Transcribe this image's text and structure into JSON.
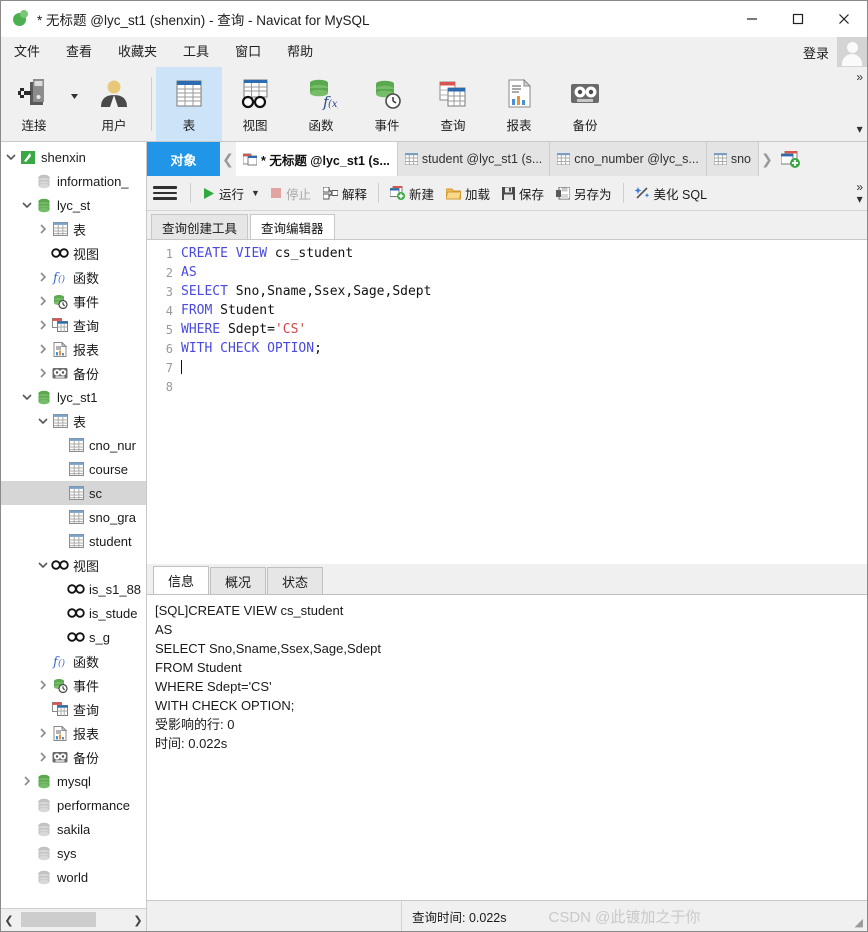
{
  "window": {
    "title": "* 无标题 @lyc_st1 (shenxin) - 查询 - Navicat for MySQL",
    "minimize": "—",
    "maximize": "□",
    "close": "✕"
  },
  "menubar": {
    "items": [
      {
        "label": "文件"
      },
      {
        "label": "查看"
      },
      {
        "label": "收藏夹"
      },
      {
        "label": "工具"
      },
      {
        "label": "窗口"
      },
      {
        "label": "帮助"
      }
    ],
    "login_label": "登录"
  },
  "ribbon": {
    "items": [
      {
        "label": "连接",
        "icon": "connection-icon",
        "selected": false
      },
      {
        "label": "用户",
        "icon": "user-icon",
        "selected": false
      },
      {
        "label": "表",
        "icon": "table-icon",
        "selected": true
      },
      {
        "label": "视图",
        "icon": "view-icon",
        "selected": false
      },
      {
        "label": "函数",
        "icon": "function-icon",
        "selected": false
      },
      {
        "label": "事件",
        "icon": "event-icon",
        "selected": false
      },
      {
        "label": "查询",
        "icon": "query-icon",
        "selected": false
      },
      {
        "label": "报表",
        "icon": "report-icon",
        "selected": false
      },
      {
        "label": "备份",
        "icon": "backup-icon",
        "selected": false
      }
    ],
    "overflow": "»",
    "more": "▾"
  },
  "sidebar": {
    "tree": [
      {
        "label": "shenxin",
        "indent": 0,
        "icon": "connection-icon",
        "arrow": "down",
        "state": "active"
      },
      {
        "label": "information_",
        "indent": 1,
        "icon": "database-gray",
        "arrow": "none",
        "state": "closed"
      },
      {
        "label": "lyc_st",
        "indent": 1,
        "icon": "database-green",
        "arrow": "down",
        "state": "open"
      },
      {
        "label": "表",
        "indent": 2,
        "icon": "table-icon",
        "arrow": "right",
        "state": "closed"
      },
      {
        "label": "视图",
        "indent": 2,
        "icon": "view-icon",
        "arrow": "none",
        "state": "closed"
      },
      {
        "label": "函数",
        "indent": 2,
        "icon": "function-icon",
        "arrow": "right",
        "state": "closed"
      },
      {
        "label": "事件",
        "indent": 2,
        "icon": "event-icon",
        "arrow": "right",
        "state": "closed"
      },
      {
        "label": "查询",
        "indent": 2,
        "icon": "query-icon",
        "arrow": "right",
        "state": "closed"
      },
      {
        "label": "报表",
        "indent": 2,
        "icon": "report-icon",
        "arrow": "right",
        "state": "closed"
      },
      {
        "label": "备份",
        "indent": 2,
        "icon": "backup-icon",
        "arrow": "right",
        "state": "closed"
      },
      {
        "label": "lyc_st1",
        "indent": 1,
        "icon": "database-green",
        "arrow": "down",
        "state": "open"
      },
      {
        "label": "表",
        "indent": 2,
        "icon": "table-icon",
        "arrow": "down",
        "state": "open"
      },
      {
        "label": "cno_nur",
        "indent": 3,
        "icon": "table-icon",
        "arrow": "none",
        "state": "closed"
      },
      {
        "label": "course",
        "indent": 3,
        "icon": "table-icon",
        "arrow": "none",
        "state": "closed"
      },
      {
        "label": "sc",
        "indent": 3,
        "icon": "table-icon",
        "arrow": "none",
        "state": "selected"
      },
      {
        "label": "sno_gra",
        "indent": 3,
        "icon": "table-icon",
        "arrow": "none",
        "state": "closed"
      },
      {
        "label": "student",
        "indent": 3,
        "icon": "table-icon",
        "arrow": "none",
        "state": "closed"
      },
      {
        "label": "视图",
        "indent": 2,
        "icon": "view-icon",
        "arrow": "down",
        "state": "open"
      },
      {
        "label": "is_s1_88",
        "indent": 3,
        "icon": "view-icon",
        "arrow": "none",
        "state": "closed"
      },
      {
        "label": "is_stude",
        "indent": 3,
        "icon": "view-icon",
        "arrow": "none",
        "state": "closed"
      },
      {
        "label": "s_g",
        "indent": 3,
        "icon": "view-icon",
        "arrow": "none",
        "state": "closed"
      },
      {
        "label": "函数",
        "indent": 2,
        "icon": "function-icon",
        "arrow": "none",
        "state": "closed"
      },
      {
        "label": "事件",
        "indent": 2,
        "icon": "event-icon",
        "arrow": "right",
        "state": "closed"
      },
      {
        "label": "查询",
        "indent": 2,
        "icon": "query-icon",
        "arrow": "none",
        "state": "closed"
      },
      {
        "label": "报表",
        "indent": 2,
        "icon": "report-icon",
        "arrow": "right",
        "state": "closed"
      },
      {
        "label": "备份",
        "indent": 2,
        "icon": "backup-icon",
        "arrow": "right",
        "state": "closed"
      },
      {
        "label": "mysql",
        "indent": 1,
        "icon": "database-green",
        "arrow": "right",
        "state": "closed"
      },
      {
        "label": "performance",
        "indent": 1,
        "icon": "database-gray",
        "arrow": "none",
        "state": "closed"
      },
      {
        "label": "sakila",
        "indent": 1,
        "icon": "database-gray",
        "arrow": "none",
        "state": "closed"
      },
      {
        "label": "sys",
        "indent": 1,
        "icon": "database-gray",
        "arrow": "none",
        "state": "closed"
      },
      {
        "label": "world",
        "indent": 1,
        "icon": "database-gray",
        "arrow": "none",
        "state": "closed"
      }
    ],
    "scroll_left": "❮",
    "scroll_right": "❯"
  },
  "doctabs": {
    "object_label": "对象",
    "nav_prev": "❮",
    "nav_next": "❯",
    "tabs": [
      {
        "label": "* 无标题 @lyc_st1 (s...",
        "icon": "query-icon",
        "active": true
      },
      {
        "label": "student @lyc_st1 (s...",
        "icon": "table-icon",
        "active": false
      },
      {
        "label": "cno_number @lyc_s...",
        "icon": "table-icon",
        "active": false
      },
      {
        "label": "sno",
        "icon": "table-icon",
        "active": false
      }
    ],
    "add_tab": "new-tab-icon"
  },
  "query_toolbar": {
    "menu_icon": "hamburger-icon",
    "buttons": [
      {
        "label": "运行",
        "icon": "run-icon",
        "enabled": true,
        "caret": true
      },
      {
        "label": "停止",
        "icon": "stop-icon",
        "enabled": false,
        "caret": false
      },
      {
        "label": "解释",
        "icon": "explain-icon",
        "enabled": true,
        "caret": false
      },
      {
        "label": "新建",
        "icon": "new-icon",
        "enabled": true,
        "caret": false
      },
      {
        "label": "加载",
        "icon": "load-icon",
        "enabled": true,
        "caret": false
      },
      {
        "label": "保存",
        "icon": "save-icon",
        "enabled": true,
        "caret": false
      },
      {
        "label": "另存为",
        "icon": "save-as-icon",
        "enabled": true,
        "caret": false
      },
      {
        "label": "美化 SQL",
        "icon": "beautify-icon",
        "enabled": true,
        "caret": false
      }
    ],
    "overflow": "»",
    "more": "▾"
  },
  "subtabs": [
    {
      "label": "查询创建工具",
      "active": false
    },
    {
      "label": "查询编辑器",
      "active": true
    }
  ],
  "editor": {
    "lines": [
      {
        "n": "1",
        "tokens": [
          {
            "t": "CREATE VIEW ",
            "c": "kw"
          },
          {
            "t": "cs_student",
            "c": "pln"
          }
        ]
      },
      {
        "n": "2",
        "tokens": [
          {
            "t": "AS",
            "c": "kw"
          }
        ]
      },
      {
        "n": "3",
        "tokens": [
          {
            "t": "SELECT ",
            "c": "kw"
          },
          {
            "t": "Sno,Sname,Ssex,Sage,Sdept",
            "c": "pln"
          }
        ]
      },
      {
        "n": "4",
        "tokens": [
          {
            "t": "FROM ",
            "c": "kw"
          },
          {
            "t": "Student",
            "c": "pln"
          }
        ]
      },
      {
        "n": "5",
        "tokens": [
          {
            "t": "WHERE ",
            "c": "kw"
          },
          {
            "t": "Sdept=",
            "c": "pln"
          },
          {
            "t": "'CS'",
            "c": "str"
          }
        ]
      },
      {
        "n": "6",
        "tokens": [
          {
            "t": "WITH CHECK OPTION",
            "c": "kw"
          },
          {
            "t": ";",
            "c": "pln"
          }
        ]
      },
      {
        "n": "7",
        "tokens": [],
        "caret": true
      },
      {
        "n": "8",
        "tokens": []
      }
    ]
  },
  "results": {
    "tabs": [
      {
        "label": "信息",
        "active": true
      },
      {
        "label": "概况",
        "active": false
      },
      {
        "label": "状态",
        "active": false
      }
    ],
    "log": [
      "[SQL]CREATE VIEW cs_student",
      "AS",
      "SELECT Sno,Sname,Ssex,Sage,Sdept",
      "FROM Student",
      "WHERE Sdept='CS'",
      "WITH CHECK OPTION;",
      "受影响的行: 0",
      "时间: 0.022s"
    ]
  },
  "statusbar": {
    "query_time": "查询时间: 0.022s",
    "watermark": "CSDN @此镀加之于你",
    "grip": "◢"
  },
  "colors": {
    "accent": "#2196e8",
    "selected_ribbon": "#cde3f7",
    "keyword": "#4a4ae0",
    "string": "#d14545",
    "green": "#4caf50"
  }
}
